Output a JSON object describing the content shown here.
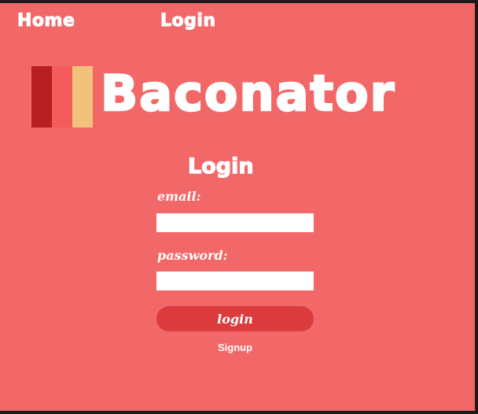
{
  "nav": {
    "home_label": "Home",
    "login_label": "Login"
  },
  "brand": {
    "name": "Baconator",
    "logo_colors": [
      "#b81f22",
      "#f45c5c",
      "#f0c27b"
    ]
  },
  "form": {
    "title": "Login",
    "email_label": "email:",
    "email_value": "",
    "password_label": "password:",
    "password_value": "",
    "submit_label": "login",
    "signup_label": "Signup"
  },
  "colors": {
    "background": "#f26868",
    "button": "#dc3b3e",
    "text": "#ffffff"
  }
}
